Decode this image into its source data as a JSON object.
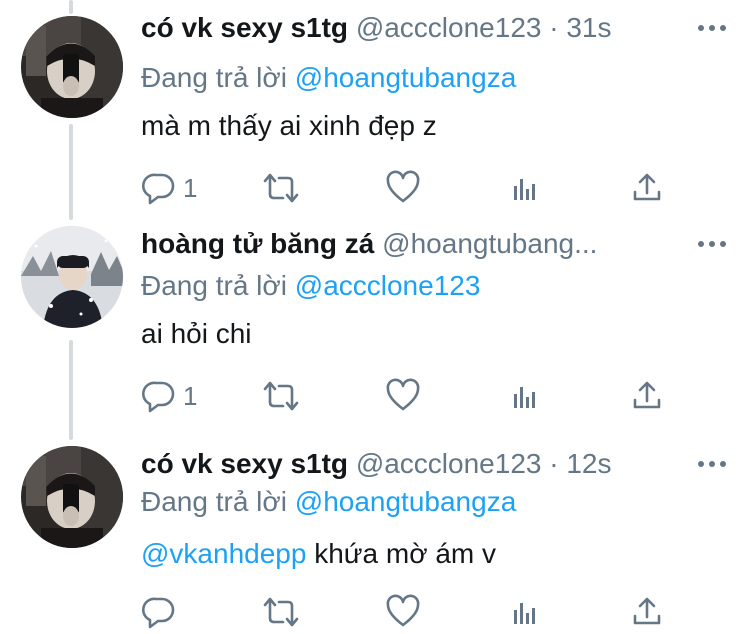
{
  "tweets": [
    {
      "display_name": "có vk sexy s1tg",
      "handle": "@accclone123",
      "separator": "·",
      "time": "31s",
      "reply_prefix": "Đang trả lời",
      "reply_to": "@hoangtubangza",
      "text_mention": "",
      "text": "mà m thấy ai xinh đẹp z",
      "reply_count": "1",
      "avatar": "mirror-selfie-photo"
    },
    {
      "display_name": "hoàng tử băng zá",
      "handle": "@hoangtubang...",
      "separator": "",
      "time": "",
      "reply_prefix": "Đang trả lời",
      "reply_to": "@accclone123",
      "text_mention": "",
      "text": "ai hỏi chi",
      "reply_count": "1",
      "avatar": "snow-portrait-photo"
    },
    {
      "display_name": "có vk sexy s1tg",
      "handle": "@accclone123",
      "separator": "·",
      "time": "12s",
      "reply_prefix": "Đang trả lời",
      "reply_to": "@hoangtubangza",
      "text_mention": "@vkanhdepp",
      "text": " khứa mờ ám v",
      "reply_count": "",
      "avatar": "mirror-selfie-photo"
    }
  ],
  "icons": {
    "reply": "reply-icon",
    "retweet": "retweet-icon",
    "like": "heart-icon",
    "analytics": "analytics-icon",
    "share": "share-icon",
    "more": "more-icon"
  },
  "colors": {
    "text": "#14171a",
    "secondary": "#657786",
    "link": "#1da1f2",
    "thread_line": "#d6dadd"
  }
}
